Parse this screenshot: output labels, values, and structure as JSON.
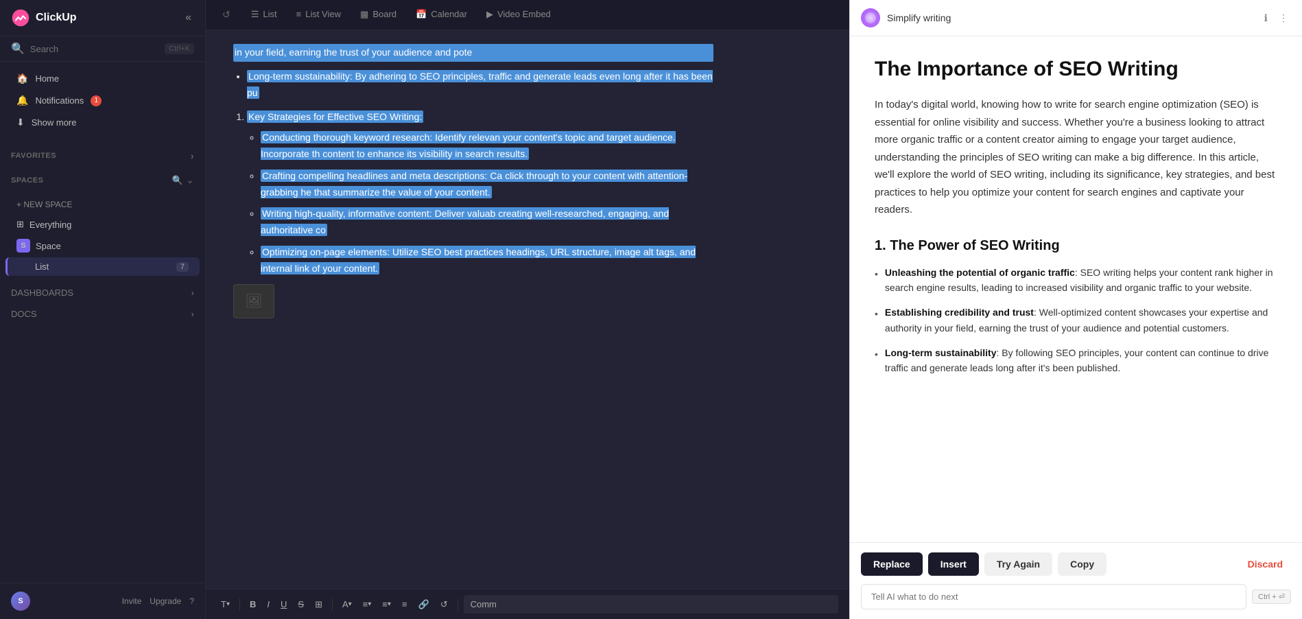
{
  "app": {
    "name": "ClickUp"
  },
  "sidebar": {
    "search_placeholder": "Search",
    "search_shortcut": "Ctrl+K",
    "collapse_label": "Collapse",
    "nav": {
      "home_label": "Home",
      "notifications_label": "Notifications",
      "notifications_badge": "1",
      "show_more_label": "Show more"
    },
    "sections": {
      "favorites_label": "FAVORITES",
      "spaces_label": "SPACES",
      "new_space_label": "+ NEW SPACE",
      "everything_label": "Everything",
      "space_label": "Space",
      "space_initial": "S",
      "list_label": "List",
      "list_count": "7",
      "dashboards_label": "DASHBOARDS",
      "docs_label": "DOCS"
    },
    "footer": {
      "invite_label": "Invite",
      "upgrade_label": "Upgrade",
      "help_label": "?"
    }
  },
  "top_bar": {
    "tabs": [
      {
        "label": "List",
        "icon": "☰"
      },
      {
        "label": "List View",
        "icon": "≡"
      },
      {
        "label": "Board",
        "icon": "▦"
      },
      {
        "label": "Calendar",
        "icon": "📅"
      },
      {
        "label": "Video Embed",
        "icon": "▶"
      }
    ]
  },
  "editor": {
    "content": {
      "top_text": "in your field, earning the trust of your audience and pote",
      "bullet1": "Long-term sustainability: By adhering to SEO principles, traffic and generate leads even long after it has been pu",
      "list_item": "Key Strategies for Effective SEO Writing:",
      "sub1": "Conducting thorough keyword research: Identify relevan your content's topic and target audience. Incorporate th content to enhance its visibility in search results.",
      "sub2": "Crafting compelling headlines and meta descriptions: Ca click through to your content with attention-grabbing he that summarize the value of your content.",
      "sub3": "Writing high-quality, informative content: Deliver valuab creating well-researched, engaging, and authoritative co",
      "sub4": "Optimizing on-page elements: Utilize SEO best practices headings, URL structure, image alt tags, and internal link of your content."
    },
    "toolbar": {
      "paragraph_label": "T",
      "bold_label": "B",
      "italic_label": "I",
      "underline_label": "U",
      "strikethrough_label": "S",
      "table_label": "⊞",
      "text_color_label": "A",
      "align_label": "≡",
      "list_label": "≡",
      "outdent_label": "≡",
      "link_label": "🔗",
      "undo_label": "↺",
      "comment_placeholder": "Comm"
    }
  },
  "ai_panel": {
    "title": "Simplify writing",
    "heading": "The Importance of SEO Writing",
    "intro": "In today's digital world, knowing how to write for search engine optimization (SEO) is essential for online visibility and success. Whether you're a business looking to attract more organic traffic or a content creator aiming to engage your target audience, understanding the principles of SEO writing can make a big difference. In this article, we'll explore the world of SEO writing, including its significance, key strategies, and best practices to help you optimize your content for search engines and captivate your readers.",
    "section1_title": "1. The Power of SEO Writing",
    "bullets": [
      {
        "bold": "Unleashing the potential of organic traffic",
        "text": ": SEO writing helps your content rank higher in search engine results, leading to increased visibility and organic traffic to your website."
      },
      {
        "bold": "Establishing credibility and trust",
        "text": ": Well-optimized content showcases your expertise and authority in your field, earning the trust of your audience and potential customers."
      },
      {
        "bold": "Long-term sustainability",
        "text": ": By following SEO principles, your content can continue to drive traffic and generate leads long after it's been published."
      }
    ],
    "actions": {
      "replace_label": "Replace",
      "insert_label": "Insert",
      "try_again_label": "Try Again",
      "copy_label": "Copy",
      "discard_label": "Discard"
    },
    "input_placeholder": "Tell AI what to do next",
    "input_shortcut": "Ctrl + ⏎"
  }
}
